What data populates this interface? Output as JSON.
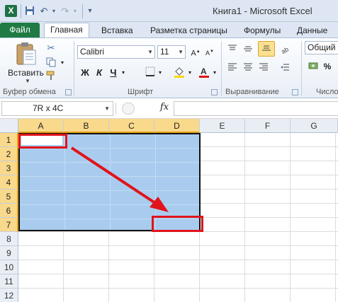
{
  "app": {
    "logo_letter": "X",
    "title": "Книга1 - Microsoft Excel"
  },
  "quick_access": {
    "save_icon": "save-icon",
    "undo_icon": "undo-icon",
    "redo_icon": "redo-icon",
    "customize_icon": "customize-quick-access-icon"
  },
  "ribbon_tabs": {
    "file": "Файл",
    "home": "Главная",
    "insert": "Вставка",
    "page_layout": "Разметка страницы",
    "formulas": "Формулы",
    "data": "Данные"
  },
  "clipboard": {
    "paste_label": "Вставить",
    "group_label": "Буфер обмена"
  },
  "font": {
    "name": "Calibri",
    "size": "11",
    "bold": "Ж",
    "italic": "К",
    "underline": "Ч",
    "group_label": "Шрифт",
    "font_color": "#e0141a",
    "fill_color": "#ffd700"
  },
  "alignment": {
    "group_label": "Выравнивание"
  },
  "number": {
    "format": "Общий",
    "group_label": "Число"
  },
  "formula_bar": {
    "name_box": "7R x 4C",
    "fx": "fx",
    "value": ""
  },
  "sheet": {
    "columns": [
      "A",
      "B",
      "C",
      "D",
      "E",
      "F",
      "G"
    ],
    "rows": [
      "1",
      "2",
      "3",
      "4",
      "5",
      "6",
      "7",
      "8",
      "9",
      "10",
      "11",
      "12"
    ],
    "selected_columns": [
      "A",
      "B",
      "C",
      "D"
    ],
    "selected_rows": [
      "1",
      "2",
      "3",
      "4",
      "5",
      "6",
      "7"
    ],
    "selection_color": "#a9ccee",
    "header_highlight": "#f9d98b"
  },
  "annotations": {
    "color": "#e0141a"
  }
}
